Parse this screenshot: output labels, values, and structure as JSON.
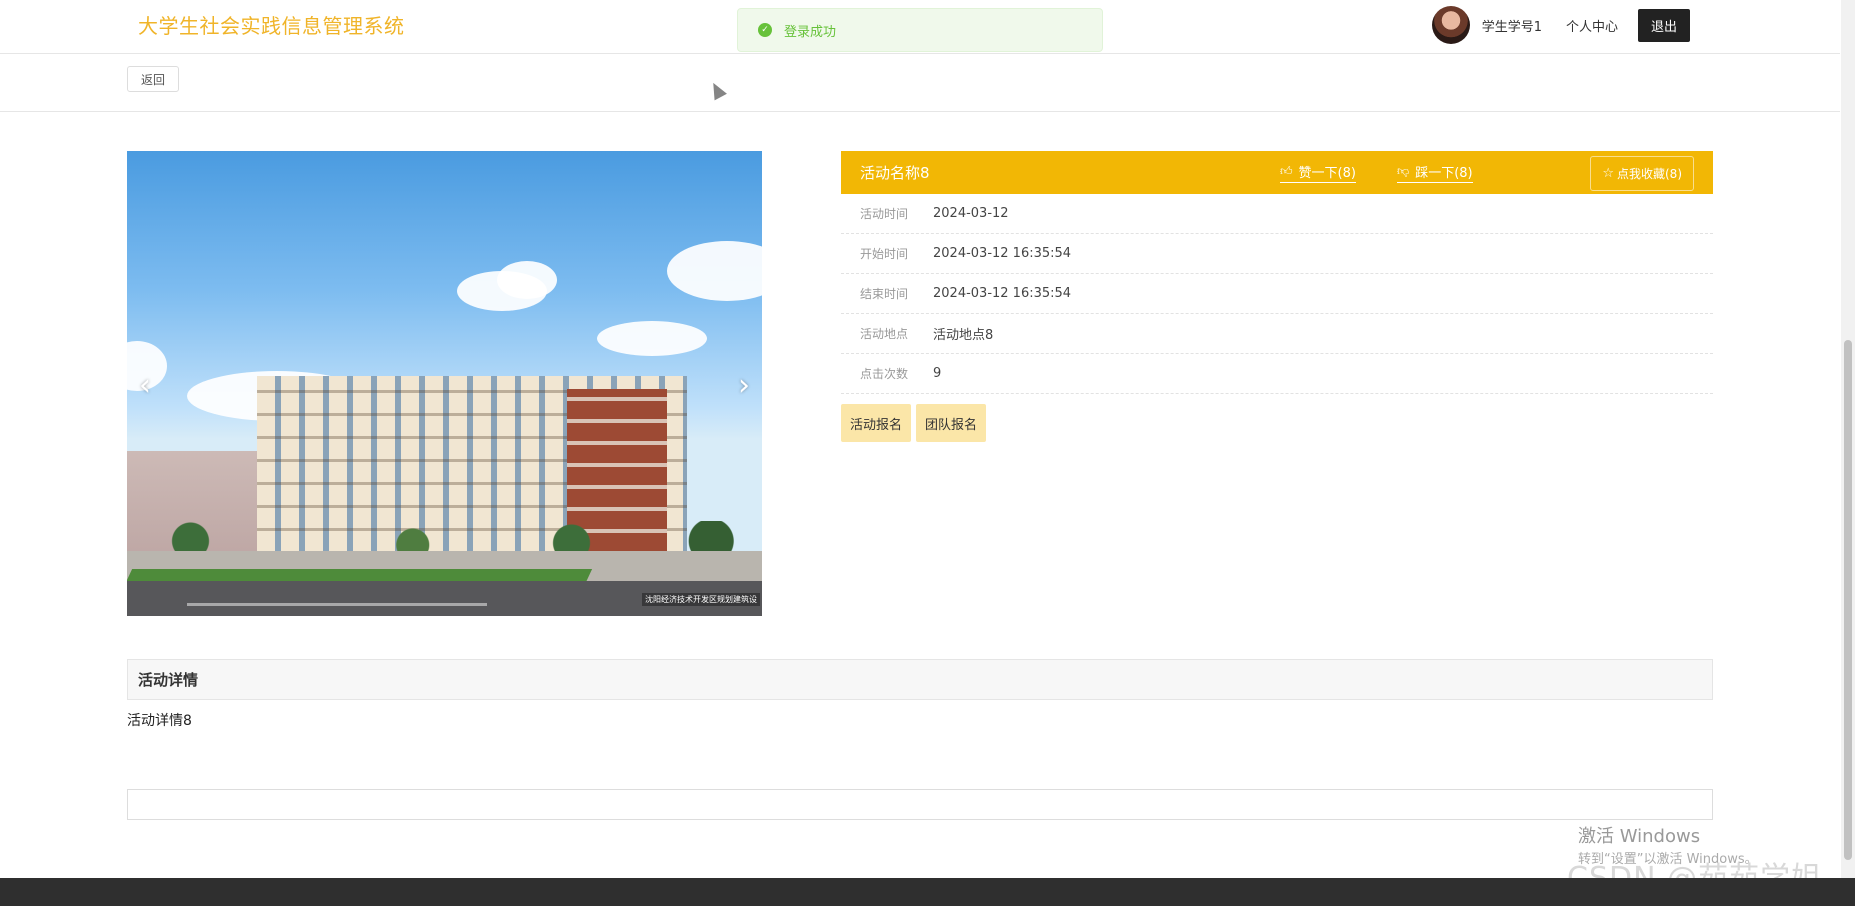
{
  "header": {
    "site_title": "大学生社会实践信息管理系统",
    "toast_message": "登录成功",
    "username": "学生学号1",
    "profile_link": "个人中心",
    "logout_label": "退出"
  },
  "subbar": {
    "back_label": "返回"
  },
  "carousel": {
    "image_watermark": "沈阳经济技术开发区规划建筑设",
    "prev_glyph": "‹",
    "next_glyph": "›"
  },
  "activity": {
    "name": "活动名称8",
    "like_label": "赞一下(8)",
    "dislike_label": "踩一下(8)",
    "favorite_label": "点我收藏(8)",
    "fields": [
      {
        "label": "活动时间",
        "value": "2024-03-12"
      },
      {
        "label": "开始时间",
        "value": "2024-03-12 16:35:54"
      },
      {
        "label": "结束时间",
        "value": "2024-03-12 16:35:54"
      },
      {
        "label": "活动地点",
        "value": "活动地点8"
      },
      {
        "label": "点击次数",
        "value": "9"
      }
    ],
    "actions": {
      "signup": "活动报名",
      "team_signup": "团队报名"
    }
  },
  "details": {
    "heading": "活动详情",
    "body": "活动详情8"
  },
  "overlay": {
    "windows_activate": "激活 Windows",
    "windows_activate_sub": "转到“设置”以激活 Windows。",
    "csdn_watermark": "CSDN @茹茹学姐"
  },
  "colors": {
    "accent": "#f2b705",
    "title": "#f0b429",
    "success": "#67c23a",
    "action_button": "#fbe6a8"
  },
  "icons": [
    "check-circle-icon",
    "thumbs-up-icon",
    "thumbs-down-icon",
    "star-icon",
    "chevron-left-icon",
    "chevron-right-icon"
  ]
}
